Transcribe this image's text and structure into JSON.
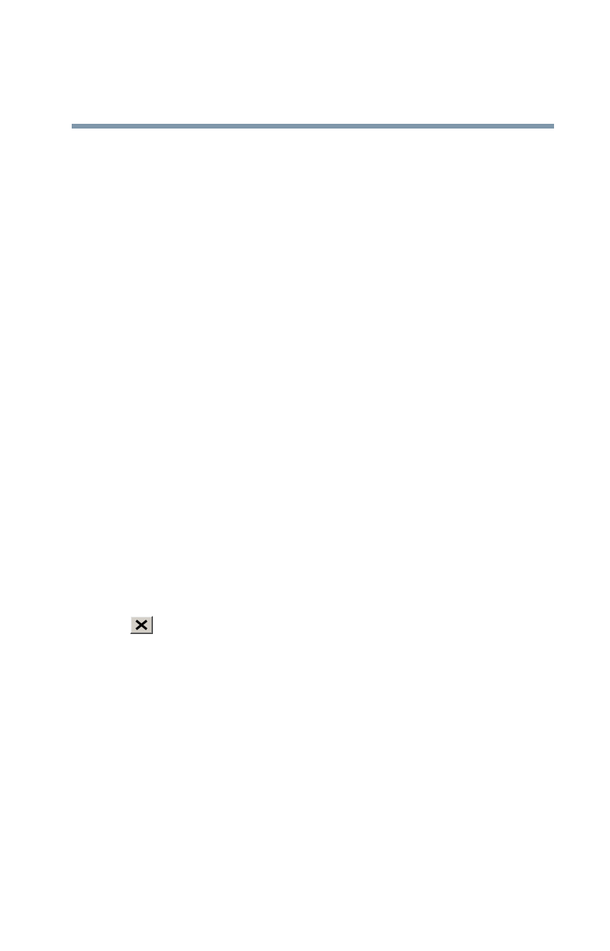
{
  "header": {
    "rule_color": "#7f97aa"
  },
  "close_button": {
    "icon": "close-icon",
    "background_color": "#d4d0c8"
  }
}
